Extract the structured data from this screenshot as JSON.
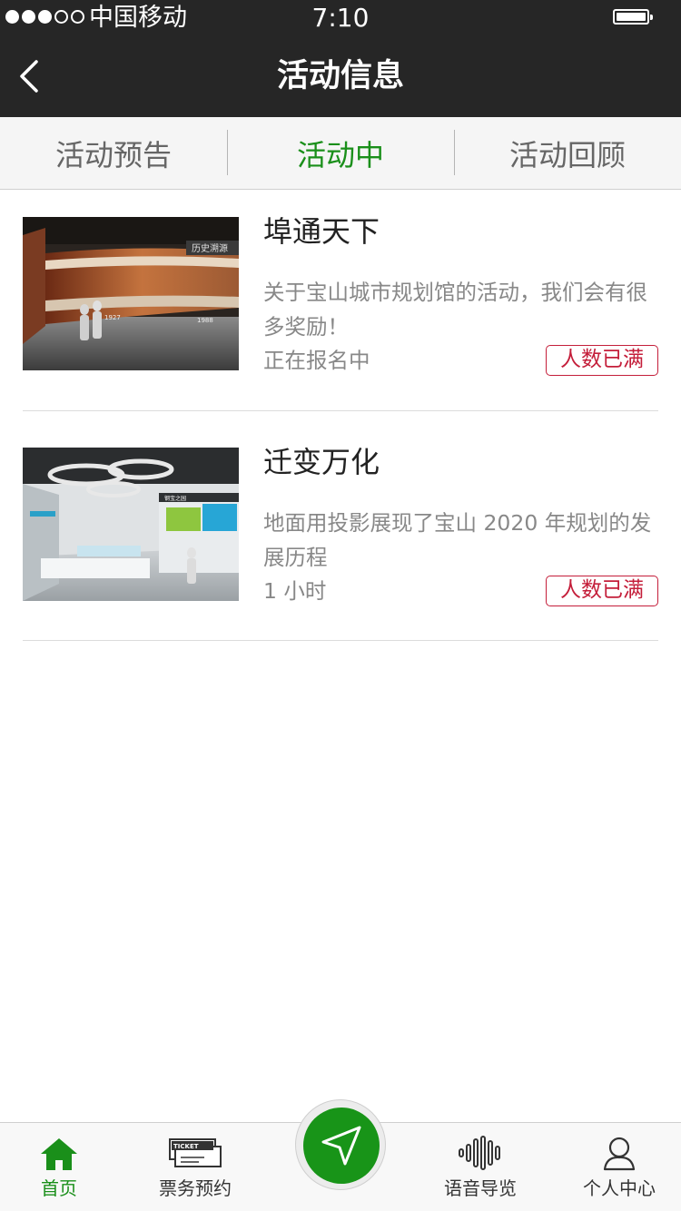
{
  "status_bar": {
    "carrier": "中国移动",
    "time": "7:10"
  },
  "nav": {
    "title": "活动信息"
  },
  "tabs": [
    {
      "label": "活动预告"
    },
    {
      "label": "活动中"
    },
    {
      "label": "活动回顾"
    }
  ],
  "activities": [
    {
      "title": "埠通天下",
      "description": "关于宝山城市规划馆的活动，我们会有很多奖励！",
      "status": "正在报名中",
      "badge": "人数已满",
      "thumb_sign": "历史溯源",
      "thumb_years": [
        "1927",
        "1988"
      ]
    },
    {
      "title": "迁变万化",
      "description": "地面用投影展现了宝山 2020 年规划的发展历程",
      "status": "1 小时",
      "badge": "人数已满",
      "thumb_sign": "钢宝之园"
    }
  ],
  "tabbar": {
    "home": "首页",
    "tickets": "票务预约",
    "ticket_icon_text": "TICKET",
    "audio": "语音导览",
    "profile": "个人中心"
  },
  "colors": {
    "accent_green": "#1a8f1a",
    "badge_red": "#c41e3a",
    "bar_dark": "#262626"
  }
}
